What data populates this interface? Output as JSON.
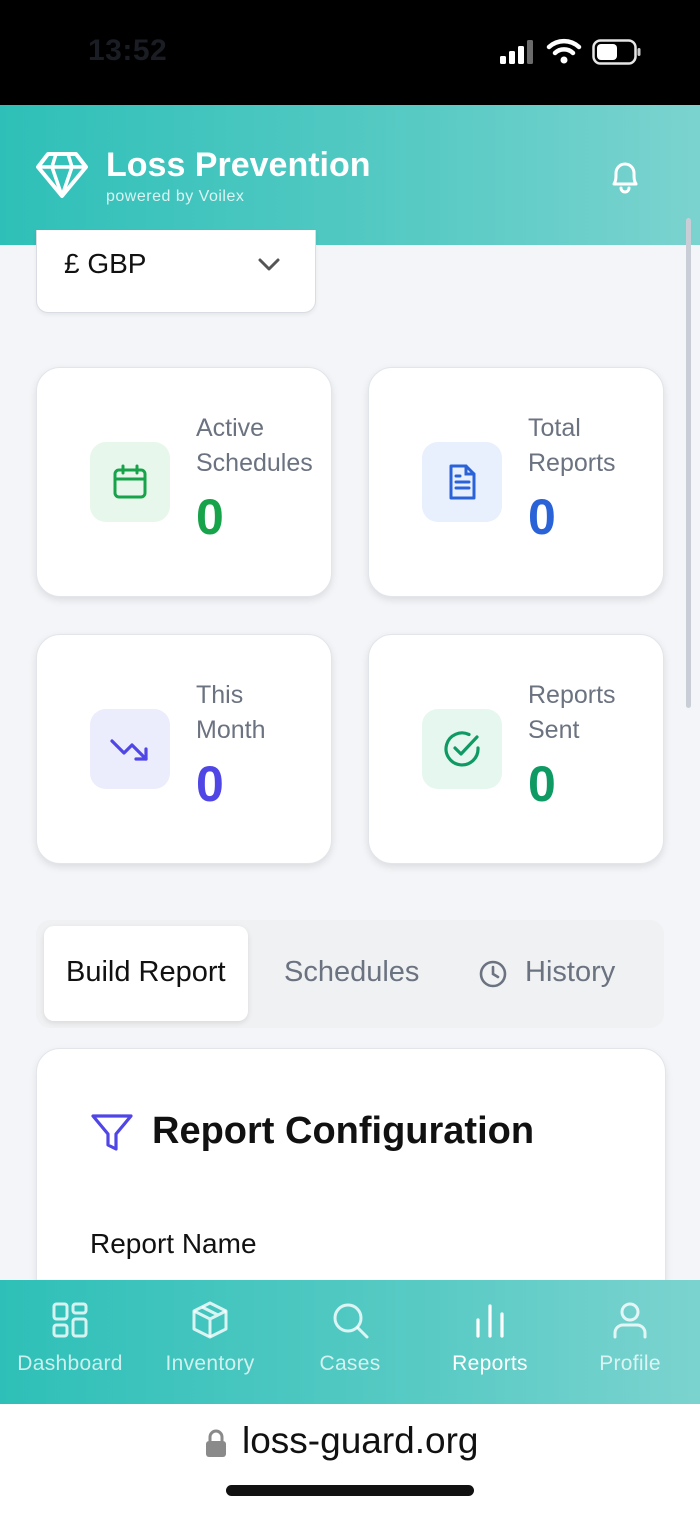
{
  "status_bar": {
    "time": "13:52"
  },
  "header": {
    "title": "Loss Prevention",
    "subtitle": "powered by Voilex"
  },
  "currency": {
    "selected": "£ GBP"
  },
  "stats": [
    {
      "label_line1": "Active",
      "label_line2": "Schedules",
      "value": "0",
      "color": "#17a34a",
      "icon": "calendar-icon"
    },
    {
      "label_line1": "Total",
      "label_line2": "Reports",
      "value": "0",
      "color": "#2a63d8",
      "icon": "document-icon"
    },
    {
      "label_line1": "This",
      "label_line2": "Month",
      "value": "0",
      "color": "#4f46e5",
      "icon": "trending-down-icon"
    },
    {
      "label_line1": "Reports",
      "label_line2": "Sent",
      "value": "0",
      "color": "#0f9a63",
      "icon": "check-circle-icon"
    }
  ],
  "tabs": [
    {
      "label": "Build Report",
      "active": true
    },
    {
      "label": "Schedules",
      "active": false
    },
    {
      "label": "History",
      "active": false,
      "icon": "clock-icon"
    }
  ],
  "report_config": {
    "title": "Report Configuration",
    "field_label": "Report Name"
  },
  "bottom_nav": [
    {
      "label": "Dashboard",
      "icon": "dashboard-icon",
      "active": false
    },
    {
      "label": "Inventory",
      "icon": "box-icon",
      "active": false
    },
    {
      "label": "Cases",
      "icon": "search-icon",
      "active": false
    },
    {
      "label": "Reports",
      "icon": "bar-chart-icon",
      "active": true
    },
    {
      "label": "Profile",
      "icon": "user-icon",
      "active": false
    }
  ],
  "browser": {
    "url": "loss-guard.org"
  },
  "colors": {
    "brand_teal": "#2ec0b8",
    "accent_purple": "#4f46e5"
  }
}
